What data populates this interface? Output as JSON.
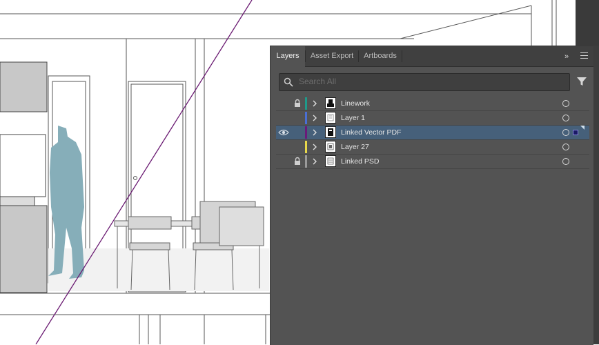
{
  "panel": {
    "tabs": [
      {
        "label": "Layers",
        "active": true
      },
      {
        "label": "Asset Export",
        "active": false
      },
      {
        "label": "Artboards",
        "active": false
      }
    ],
    "collapse_label": "»",
    "search": {
      "placeholder": "Search All",
      "value": ""
    }
  },
  "layers": [
    {
      "name": "Linework",
      "locked": true,
      "visible_icon": false,
      "color": "#1f9a8a",
      "selected": false
    },
    {
      "name": "Layer 1",
      "locked": false,
      "visible_icon": false,
      "color": "#4a6fd4",
      "selected": false
    },
    {
      "name": "Linked Vector PDF",
      "locked": false,
      "visible_icon": true,
      "color": "#6b1a7a",
      "selected": true
    },
    {
      "name": "Layer 27",
      "locked": false,
      "visible_icon": false,
      "color": "#e8d84a",
      "selected": false
    },
    {
      "name": "Linked PSD",
      "locked": true,
      "visible_icon": false,
      "color": "#9a9a9a",
      "selected": false
    }
  ],
  "colors": {
    "panel_bg": "#535353",
    "tabbar_bg": "#404040",
    "selected_row": "#46607a",
    "guide_line": "#6a1a72",
    "figure": "#86aeb9"
  },
  "icons": [
    "search-icon",
    "filter-icon",
    "eye-icon",
    "lock-icon",
    "chevron-right-icon",
    "target-icon",
    "panel-menu-icon"
  ]
}
